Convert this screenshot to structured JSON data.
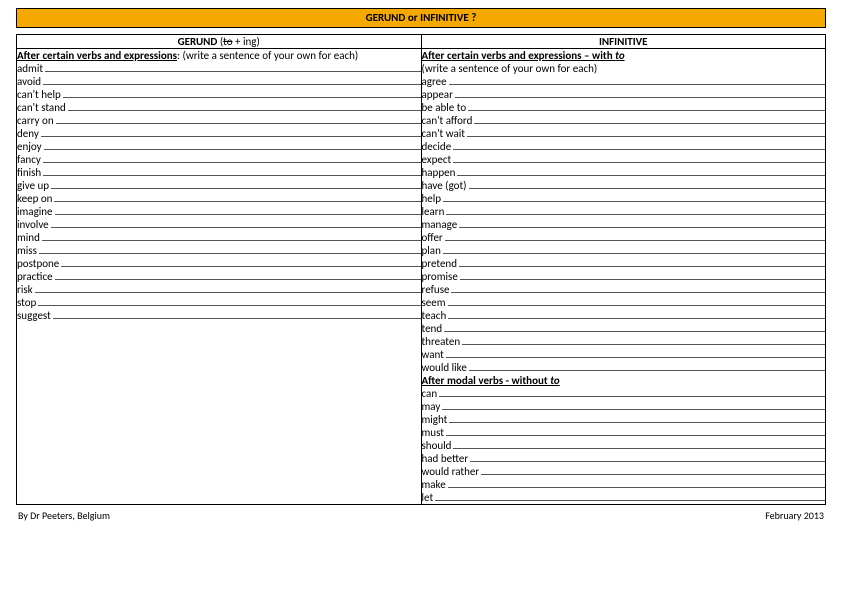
{
  "title": "GERUND or INFINITIVE ?",
  "gerund": {
    "header_prefix": "GERUND",
    "header_paren_open": " (",
    "header_to": "to",
    "header_suffix": " + ing)",
    "section_label": "After certain verbs and expressions",
    "section_tail": ": (write a sentence of your own for each)",
    "words": [
      "admit",
      "avoid",
      "can't help",
      "can't stand",
      "carry on",
      "deny",
      "enjoy",
      "fancy",
      "finish",
      "give up",
      "keep on",
      "imagine",
      "involve",
      "mind",
      "miss",
      "postpone",
      "practice",
      "risk",
      "stop",
      "suggest"
    ]
  },
  "infinitive": {
    "header": "INFINITIVE",
    "section1_label": "After certain verbs and expressions – with ",
    "section1_to": "to",
    "section1_sub": "(write a sentence of your own for each)",
    "words1": [
      "agree",
      "appear",
      "be able to",
      "can't afford",
      "can't wait",
      "decide",
      "expect",
      "happen",
      "have (got)",
      "help",
      "learn",
      "manage",
      "offer",
      "plan",
      "pretend",
      "promise",
      "refuse",
      "seem",
      "teach",
      "tend",
      "threaten",
      "want",
      "would like"
    ],
    "section2_label": "After modal verbs - without ",
    "section2_to": "to",
    "words2": [
      "can",
      "may",
      "might",
      "must",
      "should",
      "had better",
      "would rather",
      "make",
      "let"
    ]
  },
  "footer_left": "By Dr Peeters, Belgium",
  "footer_right": "February 2013"
}
